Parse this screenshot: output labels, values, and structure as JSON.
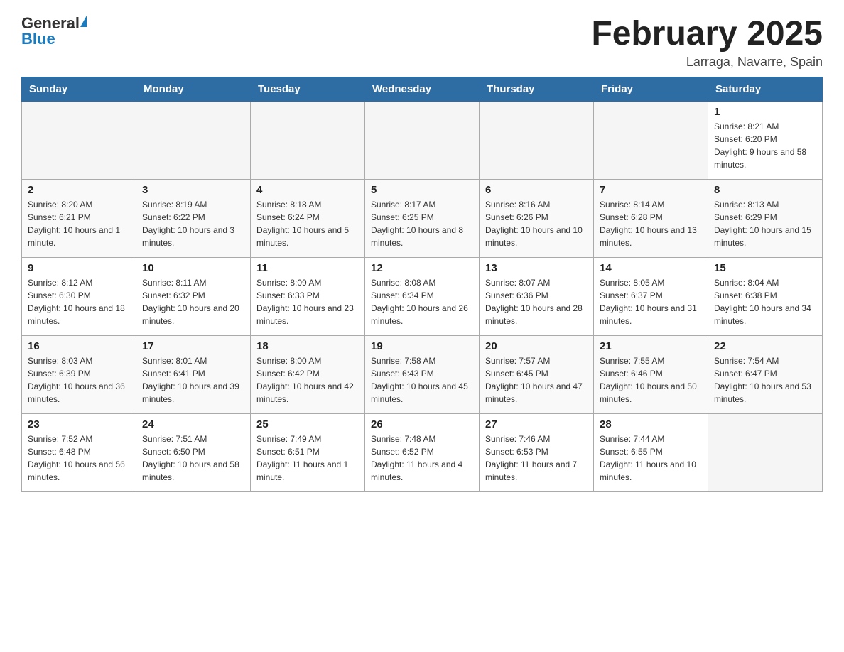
{
  "header": {
    "logo": {
      "general": "General",
      "blue": "Blue"
    },
    "title": "February 2025",
    "location": "Larraga, Navarre, Spain"
  },
  "days_of_week": [
    "Sunday",
    "Monday",
    "Tuesday",
    "Wednesday",
    "Thursday",
    "Friday",
    "Saturday"
  ],
  "weeks": [
    [
      {
        "day": "",
        "info": ""
      },
      {
        "day": "",
        "info": ""
      },
      {
        "day": "",
        "info": ""
      },
      {
        "day": "",
        "info": ""
      },
      {
        "day": "",
        "info": ""
      },
      {
        "day": "",
        "info": ""
      },
      {
        "day": "1",
        "info": "Sunrise: 8:21 AM\nSunset: 6:20 PM\nDaylight: 9 hours and 58 minutes."
      }
    ],
    [
      {
        "day": "2",
        "info": "Sunrise: 8:20 AM\nSunset: 6:21 PM\nDaylight: 10 hours and 1 minute."
      },
      {
        "day": "3",
        "info": "Sunrise: 8:19 AM\nSunset: 6:22 PM\nDaylight: 10 hours and 3 minutes."
      },
      {
        "day": "4",
        "info": "Sunrise: 8:18 AM\nSunset: 6:24 PM\nDaylight: 10 hours and 5 minutes."
      },
      {
        "day": "5",
        "info": "Sunrise: 8:17 AM\nSunset: 6:25 PM\nDaylight: 10 hours and 8 minutes."
      },
      {
        "day": "6",
        "info": "Sunrise: 8:16 AM\nSunset: 6:26 PM\nDaylight: 10 hours and 10 minutes."
      },
      {
        "day": "7",
        "info": "Sunrise: 8:14 AM\nSunset: 6:28 PM\nDaylight: 10 hours and 13 minutes."
      },
      {
        "day": "8",
        "info": "Sunrise: 8:13 AM\nSunset: 6:29 PM\nDaylight: 10 hours and 15 minutes."
      }
    ],
    [
      {
        "day": "9",
        "info": "Sunrise: 8:12 AM\nSunset: 6:30 PM\nDaylight: 10 hours and 18 minutes."
      },
      {
        "day": "10",
        "info": "Sunrise: 8:11 AM\nSunset: 6:32 PM\nDaylight: 10 hours and 20 minutes."
      },
      {
        "day": "11",
        "info": "Sunrise: 8:09 AM\nSunset: 6:33 PM\nDaylight: 10 hours and 23 minutes."
      },
      {
        "day": "12",
        "info": "Sunrise: 8:08 AM\nSunset: 6:34 PM\nDaylight: 10 hours and 26 minutes."
      },
      {
        "day": "13",
        "info": "Sunrise: 8:07 AM\nSunset: 6:36 PM\nDaylight: 10 hours and 28 minutes."
      },
      {
        "day": "14",
        "info": "Sunrise: 8:05 AM\nSunset: 6:37 PM\nDaylight: 10 hours and 31 minutes."
      },
      {
        "day": "15",
        "info": "Sunrise: 8:04 AM\nSunset: 6:38 PM\nDaylight: 10 hours and 34 minutes."
      }
    ],
    [
      {
        "day": "16",
        "info": "Sunrise: 8:03 AM\nSunset: 6:39 PM\nDaylight: 10 hours and 36 minutes."
      },
      {
        "day": "17",
        "info": "Sunrise: 8:01 AM\nSunset: 6:41 PM\nDaylight: 10 hours and 39 minutes."
      },
      {
        "day": "18",
        "info": "Sunrise: 8:00 AM\nSunset: 6:42 PM\nDaylight: 10 hours and 42 minutes."
      },
      {
        "day": "19",
        "info": "Sunrise: 7:58 AM\nSunset: 6:43 PM\nDaylight: 10 hours and 45 minutes."
      },
      {
        "day": "20",
        "info": "Sunrise: 7:57 AM\nSunset: 6:45 PM\nDaylight: 10 hours and 47 minutes."
      },
      {
        "day": "21",
        "info": "Sunrise: 7:55 AM\nSunset: 6:46 PM\nDaylight: 10 hours and 50 minutes."
      },
      {
        "day": "22",
        "info": "Sunrise: 7:54 AM\nSunset: 6:47 PM\nDaylight: 10 hours and 53 minutes."
      }
    ],
    [
      {
        "day": "23",
        "info": "Sunrise: 7:52 AM\nSunset: 6:48 PM\nDaylight: 10 hours and 56 minutes."
      },
      {
        "day": "24",
        "info": "Sunrise: 7:51 AM\nSunset: 6:50 PM\nDaylight: 10 hours and 58 minutes."
      },
      {
        "day": "25",
        "info": "Sunrise: 7:49 AM\nSunset: 6:51 PM\nDaylight: 11 hours and 1 minute."
      },
      {
        "day": "26",
        "info": "Sunrise: 7:48 AM\nSunset: 6:52 PM\nDaylight: 11 hours and 4 minutes."
      },
      {
        "day": "27",
        "info": "Sunrise: 7:46 AM\nSunset: 6:53 PM\nDaylight: 11 hours and 7 minutes."
      },
      {
        "day": "28",
        "info": "Sunrise: 7:44 AM\nSunset: 6:55 PM\nDaylight: 11 hours and 10 minutes."
      },
      {
        "day": "",
        "info": ""
      }
    ]
  ]
}
